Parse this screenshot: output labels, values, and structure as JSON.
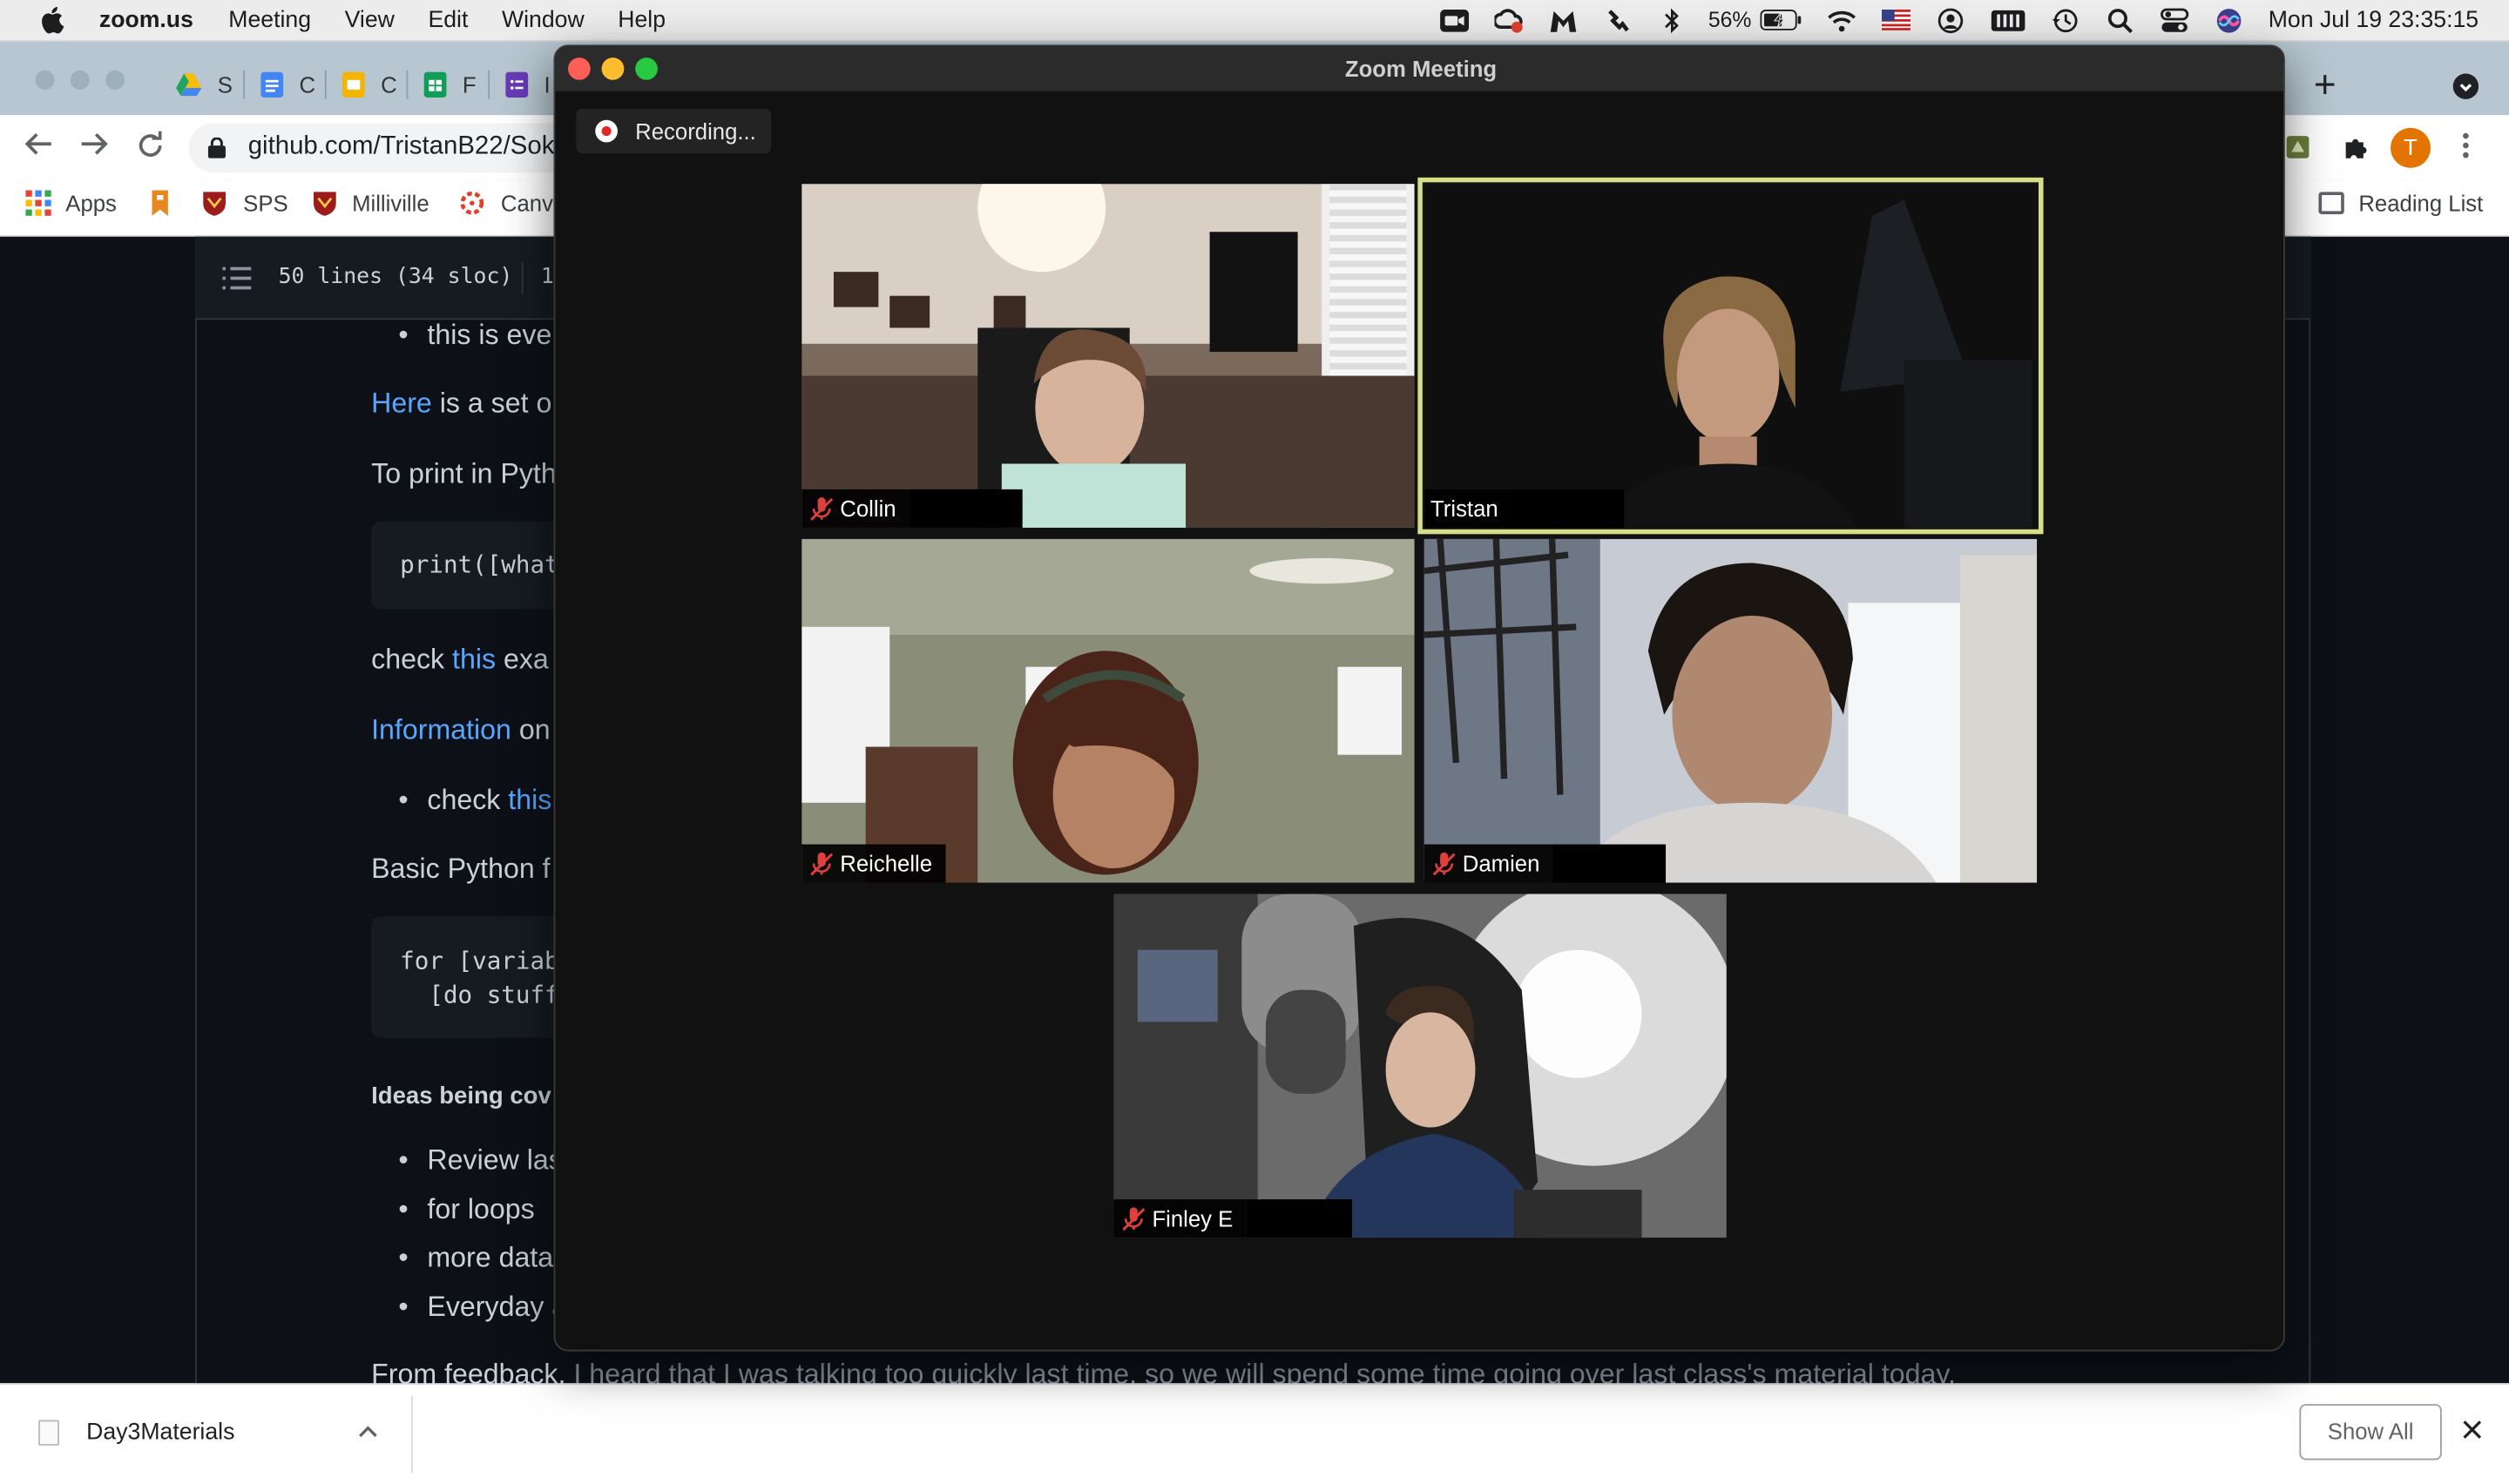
{
  "menubar": {
    "app_name": "zoom.us",
    "menus": [
      "Meeting",
      "View",
      "Edit",
      "Window",
      "Help"
    ],
    "battery_percent": "56%",
    "datetime": "Mon Jul 19  23:35:15"
  },
  "browser": {
    "tabs": [
      {
        "letter": "S",
        "icon": "google-drive-icon",
        "color": "#1fa463"
      },
      {
        "letter": "C",
        "icon": "google-docs-icon",
        "color": "#4285f4"
      },
      {
        "letter": "C",
        "icon": "google-slides-icon",
        "color": "#f4b400"
      },
      {
        "letter": "F",
        "icon": "google-sheets-icon",
        "color": "#0f9d58"
      },
      {
        "letter": "I",
        "icon": "google-forms-icon",
        "color": "#673ab7"
      }
    ],
    "url": "github.com/TristanB22/Sok",
    "profile_initial": "T",
    "bookmarks": [
      {
        "label": "Apps",
        "icon": "apps-grid-icon"
      },
      {
        "label": "",
        "icon": "bookmark-tag-icon"
      },
      {
        "label": "SPS",
        "icon": "shield-crest-icon"
      },
      {
        "label": "Milliville",
        "icon": "shield-crest-icon"
      },
      {
        "label": "Canv",
        "icon": "canvas-icon"
      }
    ],
    "reading_list": "Reading List",
    "new_tab_symbol": "+"
  },
  "github": {
    "file_lines": "50 lines (34 sloc)",
    "file_size": "1",
    "bullet_1": "this is eve",
    "here_link": "Here",
    "here_rest": " is a set o",
    "print_intro": "To print in Pyth",
    "print_code": "print([what",
    "check_text": "check ",
    "check_link": "this",
    "check_rest": " exa",
    "info_link": "Information",
    "info_rest": " on",
    "bullet_2_text": "check ",
    "bullet_2_link": "this",
    "basic_python": "Basic Python f",
    "loop_code_1": "for [variab",
    "loop_code_2": "  [do stuff",
    "ideas_heading": "Ideas being cov",
    "ideas": [
      "Review las",
      "for loops",
      "more data",
      "Everyday a"
    ],
    "feedback_start": "From feedback, ",
    "feedback_rest": "I heard that I was talking too quickly last time, so we will spend some time going over last class's material today."
  },
  "downloads": {
    "file_name": "Day3Materials",
    "show_all": "Show All"
  },
  "zoom": {
    "window_title": "Zoom Meeting",
    "recording_label": "Recording...",
    "participants": [
      {
        "name": "Collin",
        "muted": true,
        "active_speaker": false
      },
      {
        "name": "Tristan",
        "muted": false,
        "active_speaker": true
      },
      {
        "name": "Reichelle",
        "muted": true,
        "active_speaker": false
      },
      {
        "name": "Damien",
        "muted": true,
        "active_speaker": false
      },
      {
        "name": "Finley E",
        "muted": true,
        "active_speaker": false
      }
    ],
    "active_speaker_color": "#d7de8a"
  }
}
